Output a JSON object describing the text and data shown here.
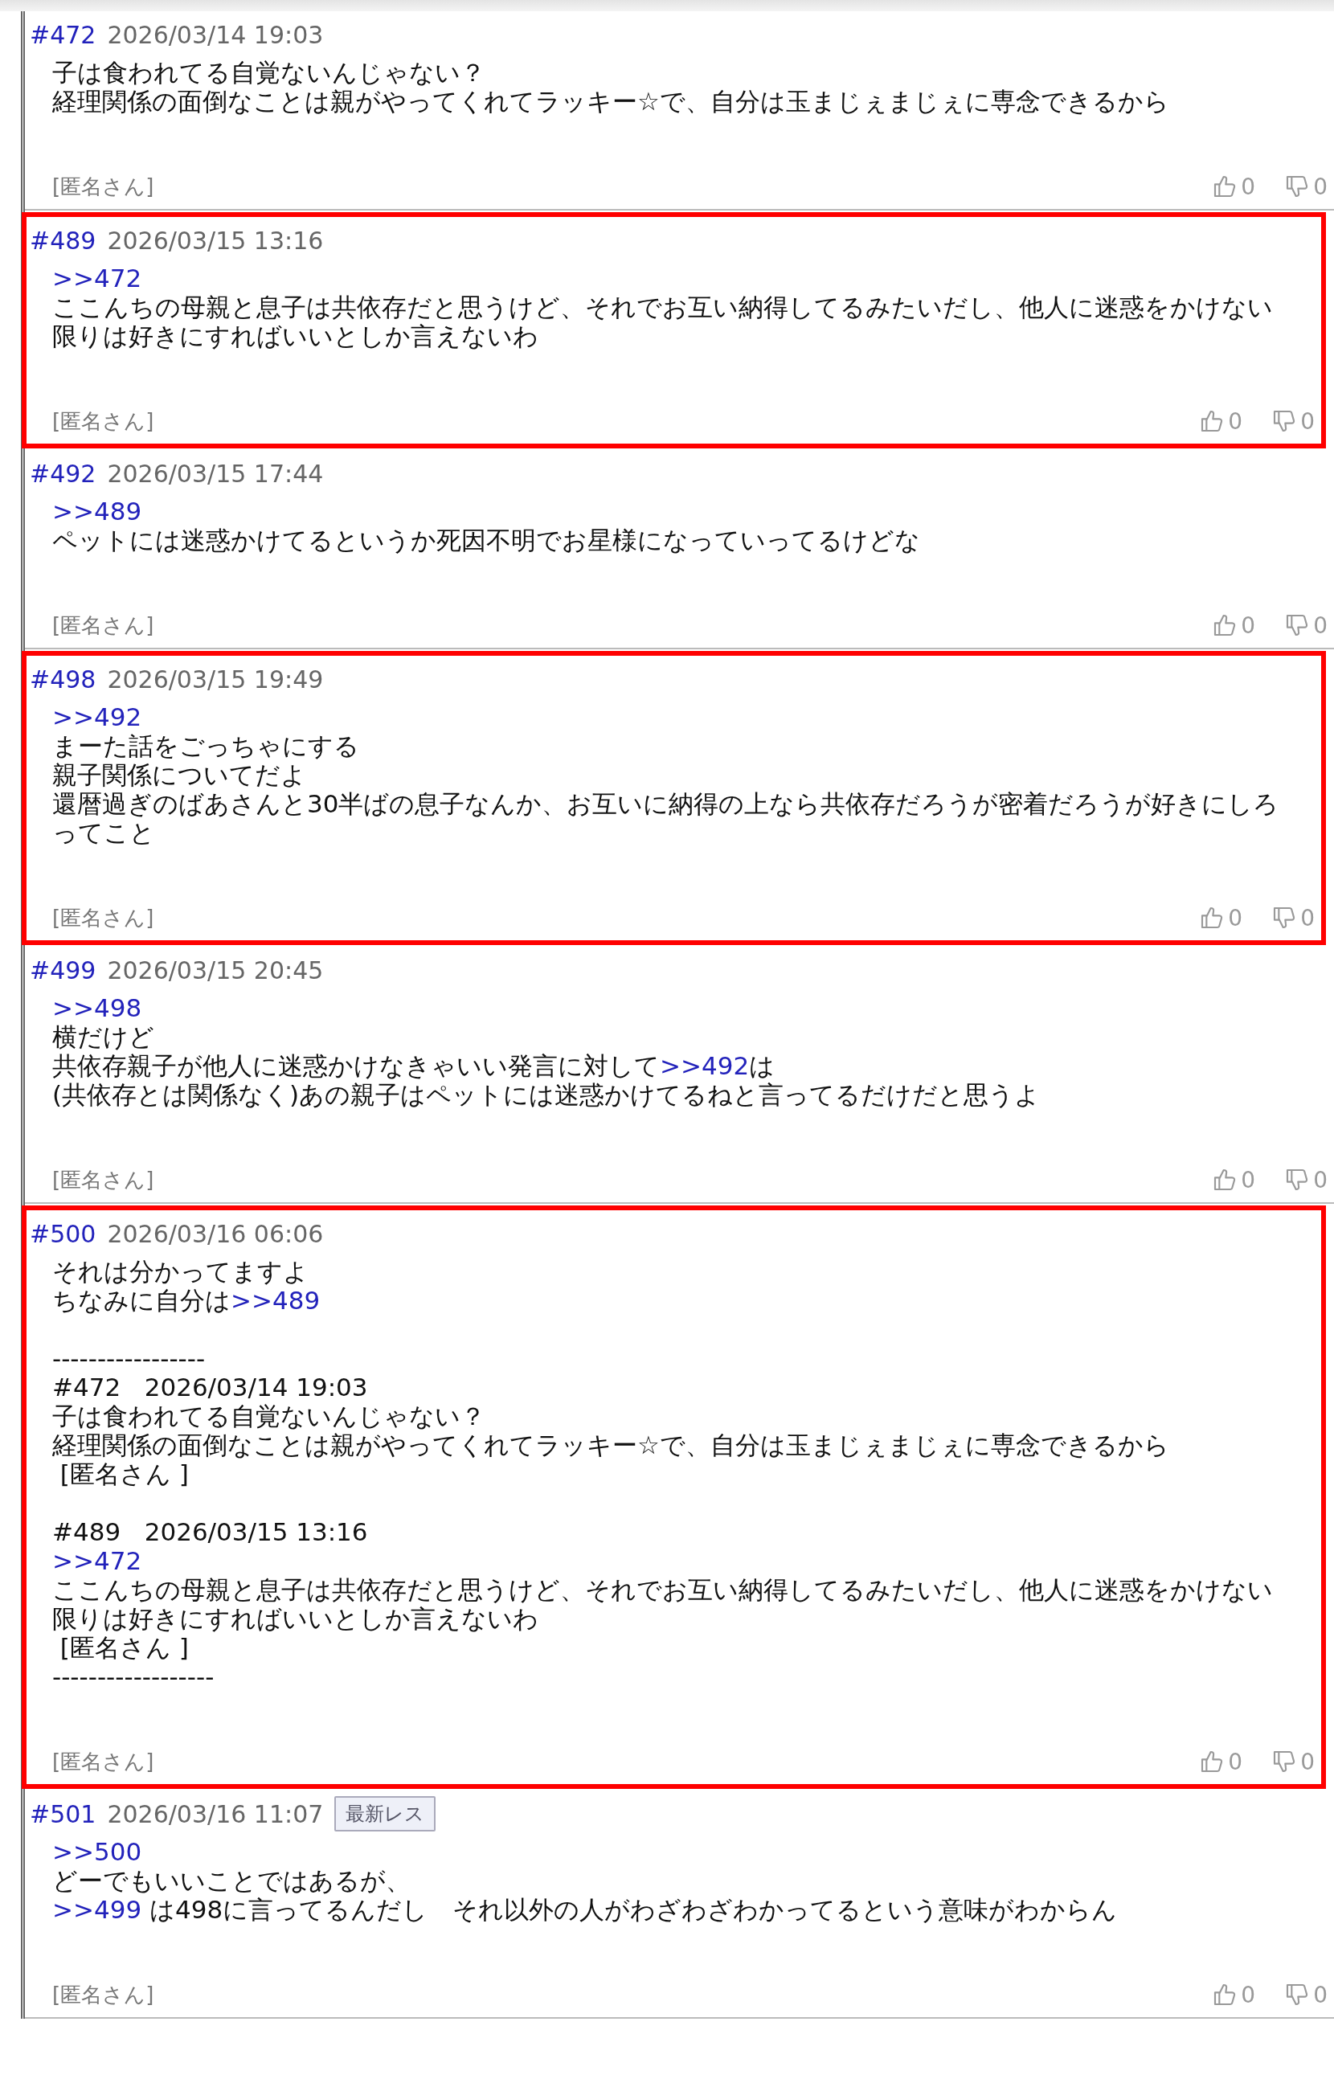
{
  "posts": [
    {
      "number": "#472",
      "date": "2026/03/14 19:03",
      "highlighted": false,
      "lines": [
        {
          "kind": "line",
          "parts": [
            {
              "kind": "text",
              "text": "子は食われてる自覚ないんじゃない？"
            }
          ]
        },
        {
          "kind": "line",
          "parts": [
            {
              "kind": "text",
              "text": "経理関係の面倒なことは親がやってくれてラッキー☆で、自分は玉まじぇまじぇに専念できるから"
            }
          ]
        }
      ],
      "author": "[匿名さん]",
      "likes": "0",
      "dislikes": "0"
    },
    {
      "number": "#489",
      "date": "2026/03/15 13:16",
      "highlighted": true,
      "lines": [
        {
          "kind": "line",
          "parts": [
            {
              "kind": "link",
              "text": ">>472"
            }
          ]
        },
        {
          "kind": "line",
          "parts": [
            {
              "kind": "text",
              "text": "ここんちの母親と息子は共依存だと思うけど、それでお互い納得してるみたいだし、他人に迷惑をかけない限りは好きにすればいいとしか言えないわ"
            }
          ]
        }
      ],
      "author": "[匿名さん]",
      "likes": "0",
      "dislikes": "0"
    },
    {
      "number": "#492",
      "date": "2026/03/15 17:44",
      "highlighted": false,
      "lines": [
        {
          "kind": "line",
          "parts": [
            {
              "kind": "link",
              "text": ">>489"
            }
          ]
        },
        {
          "kind": "line",
          "parts": [
            {
              "kind": "text",
              "text": "ペットには迷惑かけてるというか死因不明でお星様になっていってるけどな"
            }
          ]
        }
      ],
      "author": "[匿名さん]",
      "likes": "0",
      "dislikes": "0"
    },
    {
      "number": "#498",
      "date": "2026/03/15 19:49",
      "highlighted": true,
      "lines": [
        {
          "kind": "line",
          "parts": [
            {
              "kind": "link",
              "text": ">>492"
            }
          ]
        },
        {
          "kind": "line",
          "parts": [
            {
              "kind": "text",
              "text": "まーた話をごっちゃにする"
            }
          ]
        },
        {
          "kind": "line",
          "parts": [
            {
              "kind": "text",
              "text": "親子関係についてだよ"
            }
          ]
        },
        {
          "kind": "line",
          "parts": [
            {
              "kind": "text",
              "text": "還暦過ぎのばあさんと30半ばの息子なんか、お互いに納得の上なら共依存だろうが密着だろうが好きにしろってこと"
            }
          ]
        }
      ],
      "author": "[匿名さん]",
      "likes": "0",
      "dislikes": "0"
    },
    {
      "number": "#499",
      "date": "2026/03/15 20:45",
      "highlighted": false,
      "lines": [
        {
          "kind": "line",
          "parts": [
            {
              "kind": "link",
              "text": ">>498"
            }
          ]
        },
        {
          "kind": "line",
          "parts": [
            {
              "kind": "text",
              "text": "横だけど"
            }
          ]
        },
        {
          "kind": "line",
          "parts": [
            {
              "kind": "text",
              "text": "共依存親子が他人に迷惑かけなきゃいい発言に対して"
            },
            {
              "kind": "link",
              "text": ">>492"
            },
            {
              "kind": "text",
              "text": "は"
            }
          ]
        },
        {
          "kind": "line",
          "parts": [
            {
              "kind": "text",
              "text": "(共依存とは関係なく)あの親子はペットには迷惑かけてるねと言ってるだけだと思うよ"
            }
          ]
        }
      ],
      "author": "[匿名さん]",
      "likes": "0",
      "dislikes": "0"
    },
    {
      "number": "#500",
      "date": "2026/03/16 06:06",
      "highlighted": true,
      "lines": [
        {
          "kind": "line",
          "parts": [
            {
              "kind": "text",
              "text": "それは分かってますよ"
            }
          ]
        },
        {
          "kind": "line",
          "parts": [
            {
              "kind": "text",
              "text": "ちなみに自分は"
            },
            {
              "kind": "link",
              "text": ">>489"
            }
          ]
        },
        {
          "kind": "blank"
        },
        {
          "kind": "line",
          "parts": [
            {
              "kind": "text",
              "text": "-----------------"
            }
          ]
        },
        {
          "kind": "line",
          "parts": [
            {
              "kind": "text",
              "text": "#472   2026/03/14 19:03"
            }
          ]
        },
        {
          "kind": "line",
          "parts": [
            {
              "kind": "text",
              "text": "子は食われてる自覚ないんじゃない？"
            }
          ]
        },
        {
          "kind": "line",
          "parts": [
            {
              "kind": "text",
              "text": "経理関係の面倒なことは親がやってくれてラッキー☆で、自分は玉まじぇまじぇに専念できるから"
            }
          ]
        },
        {
          "kind": "line",
          "parts": [
            {
              "kind": "text",
              "text": " [匿名さん ]"
            }
          ]
        },
        {
          "kind": "blank"
        },
        {
          "kind": "line",
          "parts": [
            {
              "kind": "text",
              "text": "#489   2026/03/15 13:16"
            }
          ]
        },
        {
          "kind": "line",
          "parts": [
            {
              "kind": "link",
              "text": ">>472"
            }
          ]
        },
        {
          "kind": "line",
          "parts": [
            {
              "kind": "text",
              "text": "ここんちの母親と息子は共依存だと思うけど、それでお互い納得してるみたいだし、他人に迷惑をかけない限りは好きにすればいいとしか言えないわ"
            }
          ]
        },
        {
          "kind": "line",
          "parts": [
            {
              "kind": "text",
              "text": " [匿名さん ]"
            }
          ]
        },
        {
          "kind": "line",
          "parts": [
            {
              "kind": "text",
              "text": "------------------"
            }
          ]
        }
      ],
      "author": "[匿名さん]",
      "likes": "0",
      "dislikes": "0"
    },
    {
      "number": "#501",
      "date": "2026/03/16 11:07",
      "badge": "最新レス",
      "highlighted": false,
      "lines": [
        {
          "kind": "line",
          "parts": [
            {
              "kind": "link",
              "text": ">>500"
            }
          ]
        },
        {
          "kind": "line",
          "parts": [
            {
              "kind": "text",
              "text": "どーでもいいことではあるが、"
            }
          ]
        },
        {
          "kind": "line",
          "parts": [
            {
              "kind": "link",
              "text": ">>499"
            },
            {
              "kind": "text",
              "text": " は498に言ってるんだし　それ以外の人がわざわざわかってるという意味がわからん"
            }
          ]
        }
      ],
      "author": "[匿名さん]",
      "likes": "0",
      "dislikes": "0"
    }
  ]
}
